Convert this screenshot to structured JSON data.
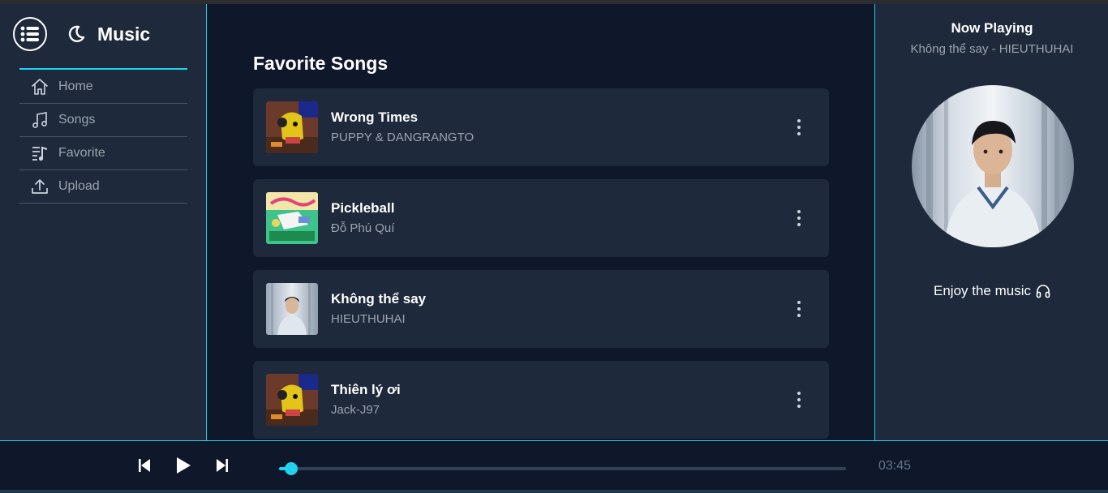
{
  "app": {
    "title": "Music"
  },
  "sidebar": {
    "items": [
      {
        "label": "Home",
        "icon": "home-icon"
      },
      {
        "label": "Songs",
        "icon": "music-note-icon"
      },
      {
        "label": "Favorite",
        "icon": "playlist-icon"
      },
      {
        "label": "Upload",
        "icon": "upload-icon"
      }
    ]
  },
  "main": {
    "title": "Favorite Songs",
    "songs": [
      {
        "title": "Wrong Times",
        "artist": "PUPPY & DANGRANGTO",
        "cover": "yellow-character-cover"
      },
      {
        "title": "Pickleball",
        "artist": "Đỗ Phú Quí",
        "cover": "pickleball-cover"
      },
      {
        "title": "Không thể say",
        "artist": "HIEUTHUHAI",
        "cover": "portrait-cover"
      },
      {
        "title": "Thiên lý ơi",
        "artist": "Jack-J97",
        "cover": "yellow-character-cover"
      }
    ]
  },
  "now_playing": {
    "heading": "Now Playing",
    "track": "Không thể say - HIEUTHUHAI",
    "enjoy": "Enjoy the music",
    "enjoy_icon": "headphones-icon"
  },
  "player": {
    "time": "03:45",
    "progress": 0.022
  },
  "colors": {
    "accent": "#22d3ee",
    "panel": "#1e293b",
    "background": "#0f172a"
  }
}
